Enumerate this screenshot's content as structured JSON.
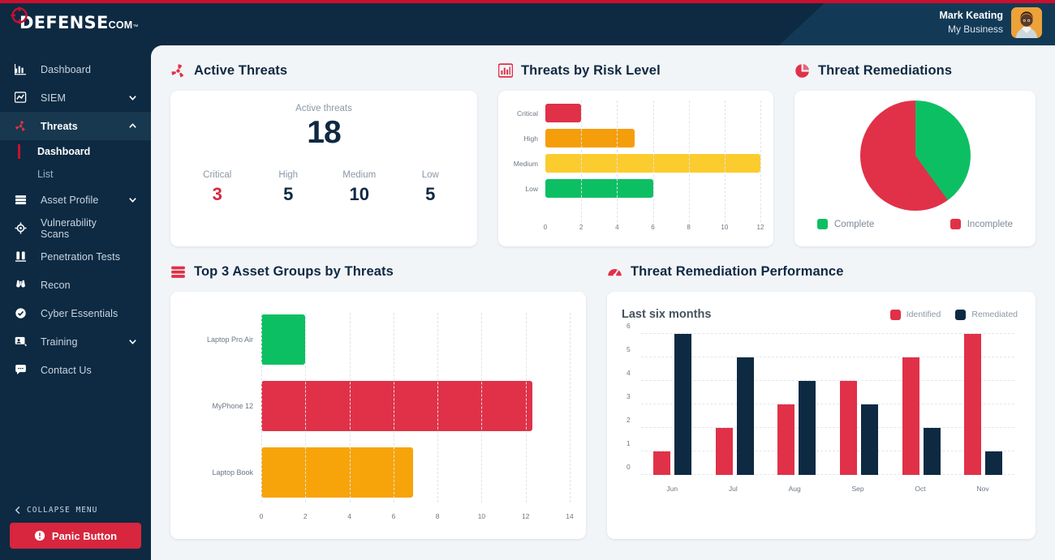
{
  "brand": {
    "logo_text": "DEFENSE",
    "logo_suffix": "COM",
    "logo_tm": "™",
    "accent_red": "#c8102e",
    "navy": "#0d2a42"
  },
  "header": {
    "user_name": "Mark Keating",
    "user_org": "My Business"
  },
  "sidebar": {
    "items": [
      {
        "label": "Dashboard",
        "icon": "chart-bar-icon",
        "expandable": false
      },
      {
        "label": "SIEM",
        "icon": "chart-line-icon",
        "expandable": true
      },
      {
        "label": "Threats",
        "icon": "radiation-icon",
        "expandable": true,
        "active": true
      },
      {
        "label": "Asset Profile",
        "icon": "server-stack-icon",
        "expandable": true
      },
      {
        "label": "Vulnerability Scans",
        "icon": "crosshair-icon",
        "expandable": false
      },
      {
        "label": "Penetration Tests",
        "icon": "test-tubes-icon",
        "expandable": false
      },
      {
        "label": "Recon",
        "icon": "binoculars-icon",
        "expandable": false
      },
      {
        "label": "Cyber Essentials",
        "icon": "check-circle-icon",
        "expandable": false
      },
      {
        "label": "Training",
        "icon": "presentation-user-icon",
        "expandable": true
      },
      {
        "label": "Contact Us",
        "icon": "chat-bubble-icon",
        "expandable": false
      }
    ],
    "sub_items": [
      {
        "label": "Dashboard",
        "current": true
      },
      {
        "label": "List",
        "current": false
      }
    ],
    "collapse_label": "COLLAPSE MENU",
    "panic_label": "Panic Button"
  },
  "cards": {
    "active_threats": {
      "title": "Active Threats",
      "icon": "radiation-icon",
      "caption": "Active threats",
      "total": "18",
      "breakdown": [
        {
          "label": "Critical",
          "value": "3",
          "critical": true
        },
        {
          "label": "High",
          "value": "5",
          "critical": false
        },
        {
          "label": "Medium",
          "value": "10",
          "critical": false
        },
        {
          "label": "Low",
          "value": "5",
          "critical": false
        }
      ]
    },
    "threats_by_risk": {
      "title": "Threats by Risk Level",
      "icon": "chart-bar-icon"
    },
    "threat_remediations": {
      "title": "Threat Remediations",
      "icon": "pie-chart-icon"
    },
    "top_asset_groups": {
      "title": "Top 3 Asset Groups by Threats",
      "icon": "server-stack-icon"
    },
    "remediation_performance": {
      "title": "Threat Remediation Performance",
      "icon": "gauge-icon",
      "subtitle": "Last six months"
    }
  },
  "chart_data": [
    {
      "id": "threats_by_risk",
      "type": "bar",
      "orientation": "horizontal",
      "title": "Threats by Risk Level",
      "categories": [
        "Critical",
        "High",
        "Medium",
        "Low"
      ],
      "values": [
        2,
        5,
        12,
        6
      ],
      "colors": [
        "#e03148",
        "#f59e0b",
        "#fbcc2e",
        "#0dbf63"
      ],
      "xlabel": "",
      "ylabel": "",
      "xlim": [
        0,
        12
      ],
      "xticks": [
        0,
        2,
        4,
        6,
        8,
        10,
        12
      ],
      "grid": true,
      "legend": "none"
    },
    {
      "id": "threat_remediations",
      "type": "pie",
      "title": "Threat Remediations",
      "labels": [
        "Complete",
        "Incomplete"
      ],
      "values": [
        40,
        60
      ],
      "colors": [
        "#0dbf63",
        "#e03148"
      ],
      "legend": "bottom"
    },
    {
      "id": "top_asset_groups",
      "type": "bar",
      "orientation": "horizontal",
      "title": "Top 3 Asset Groups by Threats",
      "categories": [
        "Laptop Pro Air",
        "MyPhone 12",
        "Laptop Book"
      ],
      "values": [
        2,
        12.3,
        6.9
      ],
      "colors": [
        "#0dbf63",
        "#e03148",
        "#f7a40a"
      ],
      "xlim": [
        0,
        14
      ],
      "xticks": [
        0,
        2,
        4,
        6,
        8,
        10,
        12,
        14
      ],
      "grid": true,
      "legend": "none"
    },
    {
      "id": "remediation_performance",
      "type": "bar",
      "orientation": "vertical",
      "title": "Threat Remediation Performance",
      "subtitle": "Last six months",
      "categories": [
        "Jun",
        "Jul",
        "Aug",
        "Sep",
        "Oct",
        "Nov"
      ],
      "series": [
        {
          "name": "Identified",
          "values": [
            1,
            2,
            3,
            4,
            5,
            6
          ],
          "color": "#e03148"
        },
        {
          "name": "Remediated",
          "values": [
            6,
            5,
            4,
            3,
            2,
            1
          ],
          "color": "#0d2a42"
        }
      ],
      "ylim": [
        0,
        6
      ],
      "yticks": [
        0,
        1,
        2,
        3,
        4,
        5,
        6
      ],
      "grid": true,
      "legend": "top-right"
    }
  ]
}
